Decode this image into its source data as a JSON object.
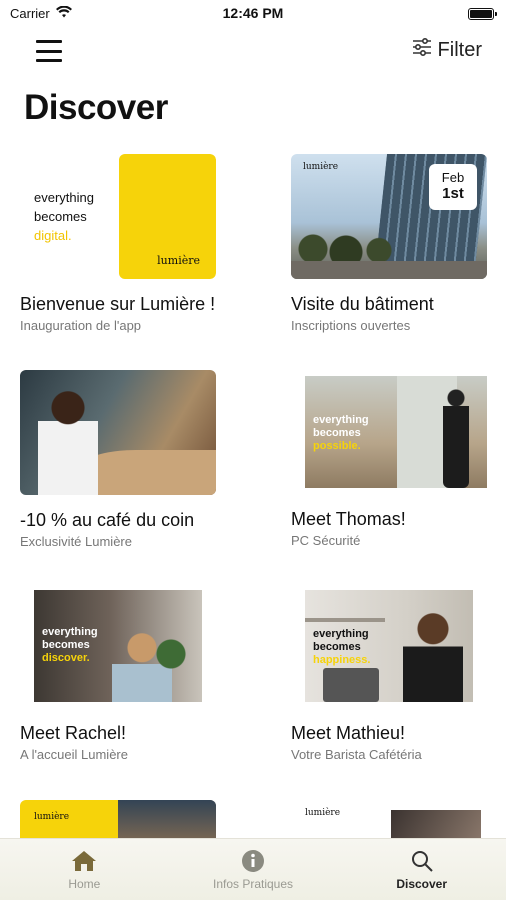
{
  "status_bar": {
    "carrier": "Carrier",
    "time": "12:46 PM"
  },
  "nav": {
    "filter_label": "Filter"
  },
  "page": {
    "title": "Discover"
  },
  "cards": [
    {
      "title": "Bienvenue sur Lumière !",
      "subtitle": "Inauguration de l'app",
      "thumb": {
        "slogan_lines": [
          "everything",
          "becomes"
        ],
        "slogan_accent": "digital.",
        "logo": "lumière"
      }
    },
    {
      "title": "Visite du bâtiment",
      "subtitle": "Inscriptions ouvertes",
      "thumb": {
        "logo": "lumière",
        "date_month": "Feb",
        "date_day": "1st"
      }
    },
    {
      "title": "-10 % au café du coin",
      "subtitle": "Exclusivité Lumière"
    },
    {
      "title": "Meet Thomas!",
      "subtitle": "PC Sécurité",
      "thumb": {
        "slogan_lines": [
          "everything",
          "becomes"
        ],
        "slogan_accent": "possible."
      }
    },
    {
      "title": "Meet Rachel!",
      "subtitle": "A l'accueil Lumière",
      "thumb": {
        "slogan_lines": [
          "everything",
          "becomes"
        ],
        "slogan_accent": "discover."
      }
    },
    {
      "title": "Meet Mathieu!",
      "subtitle": "Votre Barista Cafétéria",
      "thumb": {
        "slogan_lines": [
          "everything",
          "becomes"
        ],
        "slogan_accent": "happiness."
      }
    },
    {
      "title": "",
      "subtitle": "",
      "thumb": {
        "logo": "lumière"
      }
    },
    {
      "title": "",
      "subtitle": "",
      "thumb": {
        "logo": "lumière"
      }
    }
  ],
  "tabs": [
    {
      "label": "Home",
      "icon": "home-icon",
      "active": false
    },
    {
      "label": "Infos Pratiques",
      "icon": "info-icon",
      "active": false
    },
    {
      "label": "Discover",
      "icon": "search-icon",
      "active": true
    }
  ],
  "colors": {
    "brand_yellow": "#f6d30a",
    "tab_active": "#222222",
    "tab_inactive": "#9a9a92",
    "icon_inactive": "#8a8a80",
    "home_icon": "#7a6a3a"
  }
}
